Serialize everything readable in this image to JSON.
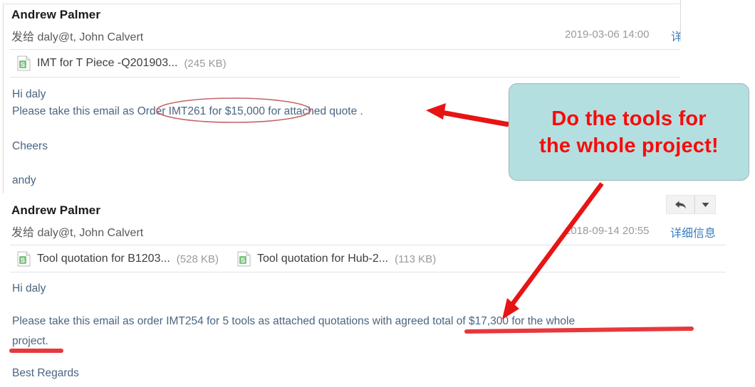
{
  "emails": [
    {
      "sender": "Andrew Palmer",
      "to_label": "发给",
      "to_address": "daly@",
      "to_suffix": "t, John Calvert",
      "timestamp": "2019-03-06 14:00",
      "detail_link": "详",
      "attachments": [
        {
          "icon": "spreadsheet-icon",
          "name": "IMT for T Piece -Q201903...",
          "size": "(245 KB)"
        }
      ],
      "body_lines": [
        "Hi daly",
        "Please take this email as Order IMT261 for $15,000 for attached quote .",
        "",
        "Cheers",
        "",
        "andy"
      ]
    },
    {
      "sender": "Andrew Palmer",
      "to_label": "发给",
      "to_address": "daly@",
      "to_suffix": "t, John Calvert",
      "timestamp": "2018-09-14 20:55",
      "detail_link": "详细信息",
      "reply_button": "reply-icon",
      "reply_menu_button": "chevron-down-icon",
      "attachments": [
        {
          "icon": "spreadsheet-icon",
          "name": "Tool quotation for B1203...",
          "size": "(528 KB)"
        },
        {
          "icon": "spreadsheet-icon",
          "name": "Tool quotation for Hub-2...",
          "size": "(113 KB)"
        }
      ],
      "body_lines": [
        "Hi daly",
        "",
        "Please take this email as order IMT254  for 5 tools as attached quotations with agreed total of $17,300 for the whole",
        "project.",
        "",
        "Best Regards"
      ]
    }
  ],
  "callout": {
    "line1": "Do the tools for",
    "line2": "the whole project!",
    "fill_color": "#b4dfe1",
    "text_color": "#fa0a0a"
  },
  "annotations": {
    "ellipse_label": "red-ellipse-order-amount",
    "arrow_to_order_label": "red-arrow-to-order-line",
    "arrow_to_total_label": "red-arrow-to-agreed-total",
    "underline_total_label": "red-underline-agreed-total",
    "underline_project_label": "red-underline-project",
    "stroke_color": "#e81414",
    "ellipse_stroke_color": "#c4646a"
  }
}
